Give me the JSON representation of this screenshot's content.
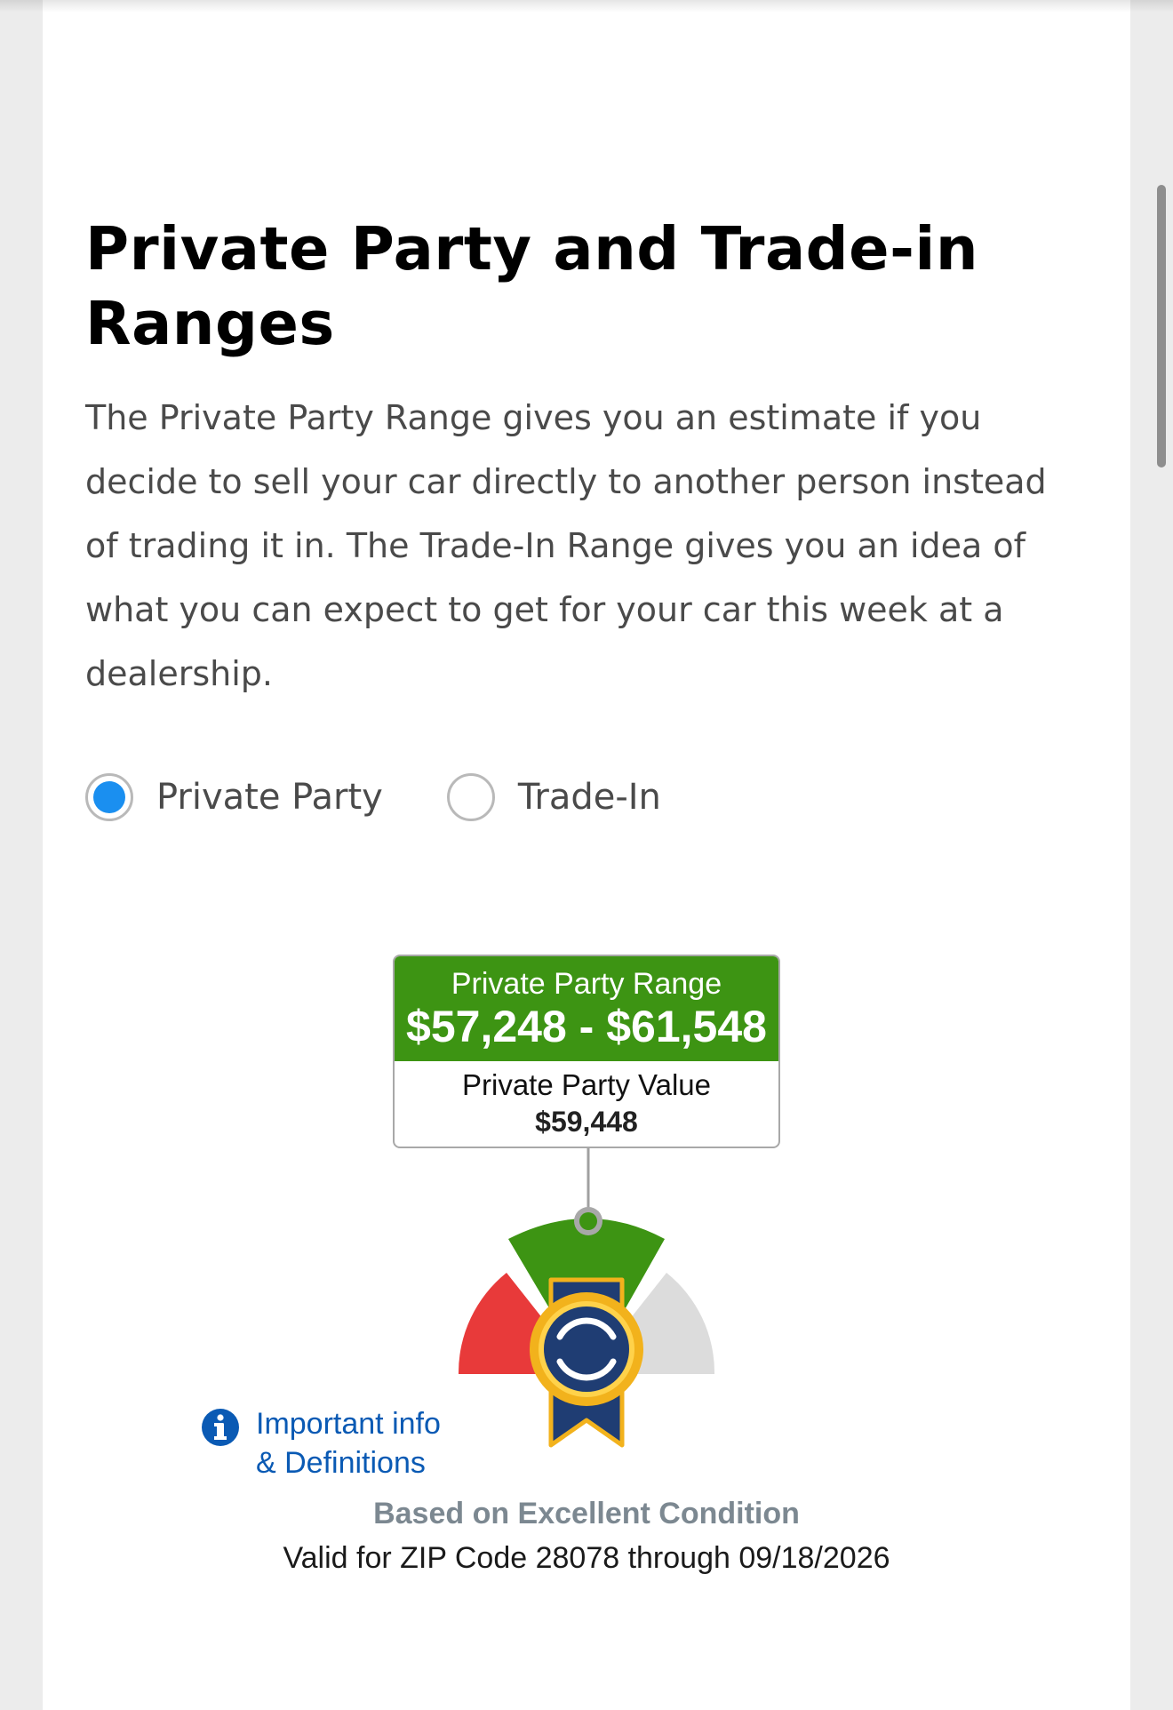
{
  "section": {
    "title": "Private Party and Trade-in Ranges",
    "description": "The Private Party Range gives you an estimate if you decide to sell your car directly to another person instead of trading it in. The Trade-In Range gives you an idea of what you can expect to get for your car this week at a dealership."
  },
  "options": {
    "private_party": {
      "label": "Private Party",
      "selected": true
    },
    "trade_in": {
      "label": "Trade-In",
      "selected": false
    }
  },
  "range_box": {
    "range_title": "Private Party Range",
    "range_values": "$57,248 - $61,548",
    "value_title": "Private Party Value",
    "value_amount": "$59,448"
  },
  "gauge": {
    "low_color": "#e83a3a",
    "mid_color": "#3d9413",
    "high_color": "#dcdcdc",
    "badge_color": "#1f3d73",
    "badge_border_color": "#f2b21c",
    "icon": "kbb-ribbon-badge-icon"
  },
  "info": {
    "icon": "info-icon",
    "line1": "Important info",
    "line2": "& Definitions",
    "color": "#0a5ab4"
  },
  "footer": {
    "condition": "Based on Excellent Condition",
    "validity": "Valid for ZIP Code 28078 through 09/18/2026"
  },
  "colors": {
    "accent": "#1a8ff0",
    "range_green": "#3d9413"
  }
}
